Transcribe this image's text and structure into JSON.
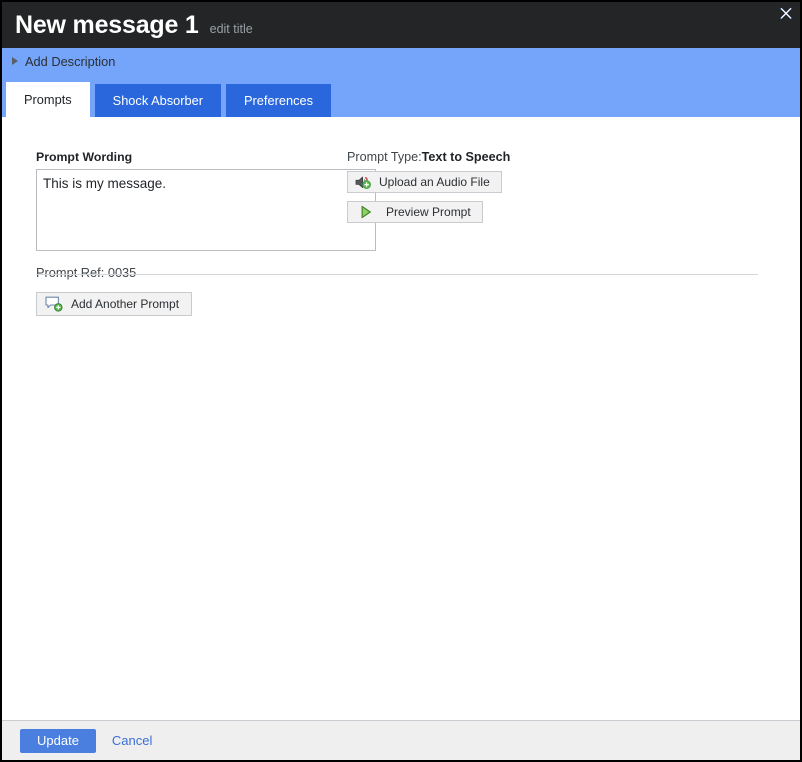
{
  "window": {
    "title": "New message 1",
    "edit_title_label": "edit title",
    "close_icon": "close-icon"
  },
  "description_bar": {
    "label": "Add Description",
    "disclosure_icon": "chevron-right-icon",
    "background_color": "#74a5fb"
  },
  "tabs": [
    {
      "label": "Prompts",
      "active": true
    },
    {
      "label": "Shock Absorber",
      "active": false
    },
    {
      "label": "Preferences",
      "active": false
    }
  ],
  "main": {
    "prompt_wording": {
      "label": "Prompt Wording",
      "value": "This is my message.",
      "placeholder": ""
    },
    "prompt_ref": "Prompt Ref: 0035",
    "prompt_type": {
      "label": "Prompt Type:",
      "value": "Text to Speech"
    },
    "buttons": [
      {
        "label": "Upload an Audio File",
        "icon": "speaker-add-icon"
      },
      {
        "label": "Preview Prompt",
        "icon": "play-icon"
      }
    ],
    "add_another": {
      "label": "Add Another Prompt",
      "icon": "speech-bubble-add-icon"
    }
  },
  "footer": {
    "update_label": "Update",
    "cancel_label": "Cancel",
    "primary_color": "#4a7fe0"
  }
}
